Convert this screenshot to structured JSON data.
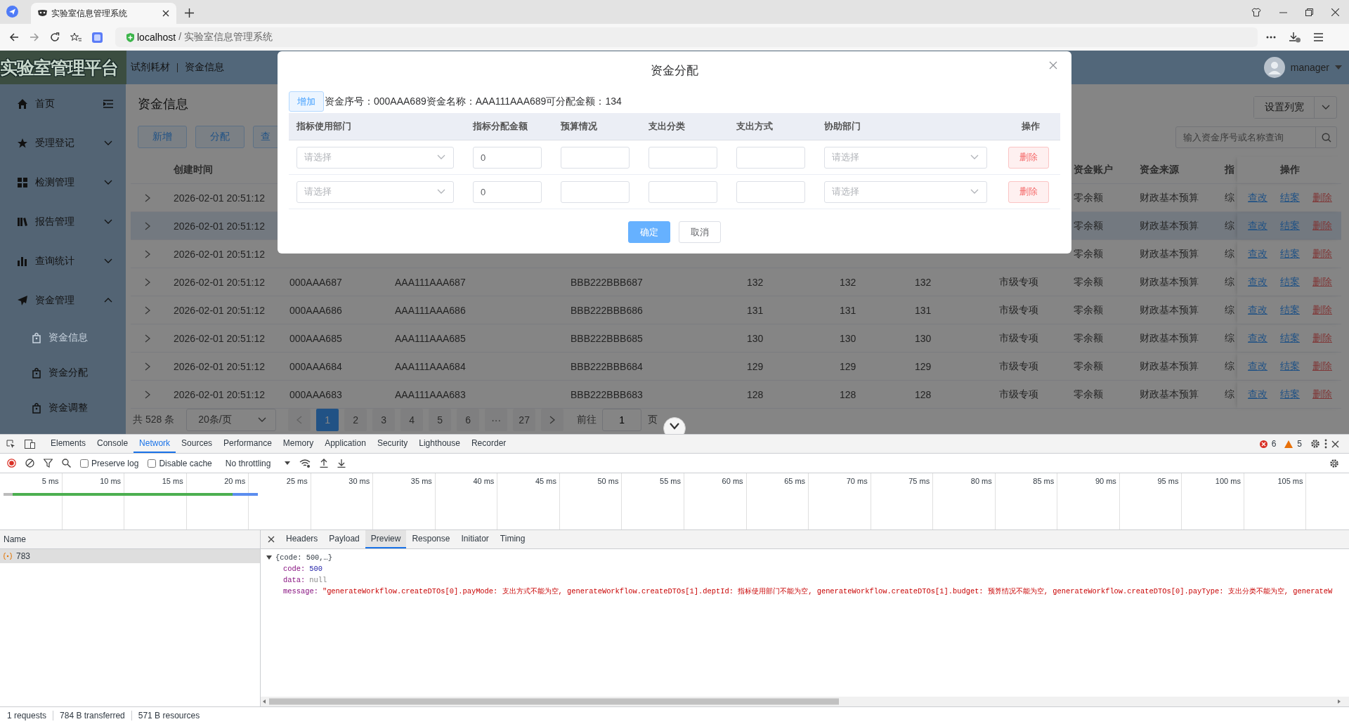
{
  "browser": {
    "tab_title": "实验室信息管理系统",
    "address": {
      "host": "localhost",
      "path": "/ 实验室信息管理系统"
    }
  },
  "header": {
    "logo": "实验室管理平台",
    "breadcrumbs": [
      "试剂耗材",
      "资金信息"
    ],
    "user": "manager"
  },
  "sidebar": {
    "items": [
      {
        "label": "首页",
        "kind": "link"
      },
      {
        "label": "受理登记",
        "kind": "group",
        "expanded": false
      },
      {
        "label": "检测管理",
        "kind": "group",
        "expanded": false
      },
      {
        "label": "报告管理",
        "kind": "group",
        "expanded": false
      },
      {
        "label": "查询统计",
        "kind": "group",
        "expanded": false
      },
      {
        "label": "资金管理",
        "kind": "group",
        "expanded": true,
        "children": [
          {
            "label": "资金信息",
            "selected": true
          },
          {
            "label": "资金分配",
            "selected": false
          },
          {
            "label": "资金调整",
            "selected": false
          }
        ]
      }
    ]
  },
  "page": {
    "title": "资金信息",
    "buttons": [
      "新增",
      "分配",
      "查"
    ],
    "column_width_button": "设置列宽",
    "search": {
      "placeholder": "输入资金序号或名称查询"
    }
  },
  "table": {
    "columns": {
      "time": "创建时间",
      "account": "资金账户",
      "source": "资金来源",
      "indicator": "指",
      "actions": "操作"
    },
    "rows": [
      {
        "time": "2026-02-01 20:51:12",
        "account": "零余额",
        "source": "财政基本预算",
        "indicator": "综",
        "actions": [
          "查改",
          "结案",
          "删除"
        ],
        "selected": false
      },
      {
        "time": "2026-02-01 20:51:12",
        "account": "零余额",
        "source": "财政基本预算",
        "indicator": "综",
        "actions": [
          "查改",
          "结案",
          "删除"
        ],
        "selected": true
      },
      {
        "time": "2026-02-01 20:51:12",
        "account": "零余额",
        "source": "财政基本预算",
        "indicator": "综",
        "actions": [
          "查改",
          "结案",
          "删除"
        ],
        "selected": false
      },
      {
        "time": "2026-02-01 20:51:12",
        "column_2": "000AAA687",
        "column_3": "AAA111AAA687",
        "column_4": "BBB222BBB687",
        "column_5": "132",
        "column_6": "132",
        "column_7": "132",
        "column_8": "市级专项",
        "account": "零余额",
        "source": "财政基本预算",
        "indicator": "综",
        "actions": [
          "查改",
          "结案",
          "删除"
        ],
        "selected": false
      },
      {
        "time": "2026-02-01 20:51:12",
        "column_2": "000AAA686",
        "column_3": "AAA111AAA686",
        "column_4": "BBB222BBB686",
        "column_5": "131",
        "column_6": "131",
        "column_7": "131",
        "column_8": "市级专项",
        "account": "零余额",
        "source": "财政基本预算",
        "indicator": "综",
        "actions": [
          "查改",
          "结案",
          "删除"
        ],
        "selected": false
      },
      {
        "time": "2026-02-01 20:51:12",
        "column_2": "000AAA685",
        "column_3": "AAA111AAA685",
        "column_4": "BBB222BBB685",
        "column_5": "130",
        "column_6": "130",
        "column_7": "130",
        "column_8": "市级专项",
        "account": "零余额",
        "source": "财政基本预算",
        "indicator": "综",
        "actions": [
          "查改",
          "结案",
          "删除"
        ],
        "selected": false
      },
      {
        "time": "2026-02-01 20:51:12",
        "column_2": "000AAA684",
        "column_3": "AAA111AAA684",
        "column_4": "BBB222BBB684",
        "column_5": "129",
        "column_6": "129",
        "column_7": "129",
        "column_8": "市级专项",
        "account": "零余额",
        "source": "财政基本预算",
        "indicator": "综",
        "actions": [
          "查改",
          "结案",
          "删除"
        ],
        "selected": false
      },
      {
        "time": "2026-02-01 20:51:12",
        "column_2": "000AAA683",
        "column_3": "AAA111AAA683",
        "column_4": "BBB222BBB683",
        "column_5": "128",
        "column_6": "128",
        "column_7": "128",
        "column_8": "市级专项",
        "account": "零余额",
        "source": "财政基本预算",
        "indicator": "综",
        "actions": [
          "查改",
          "结案",
          "删除"
        ],
        "selected": false
      }
    ]
  },
  "pagination": {
    "total": "共 528 条",
    "page_size": "20条/页",
    "pages": [
      {
        "label": "1",
        "selected": true
      },
      {
        "label": "2",
        "selected": false
      },
      {
        "label": "3",
        "selected": false
      },
      {
        "label": "4",
        "selected": false
      },
      {
        "label": "5",
        "selected": false
      },
      {
        "label": "6",
        "selected": false
      },
      {
        "label": "···",
        "selected": false
      },
      {
        "label": "27",
        "selected": false
      }
    ],
    "goto_label": "前往",
    "goto_value": "1",
    "goto_suffix": "页"
  },
  "dialog": {
    "title": "资金分配",
    "add_button": "增加",
    "info": "资金序号：000AAA689资金名称：AAA111AAA689可分配金额：134",
    "columns": [
      "指标使用部门",
      "指标分配金额",
      "预算情况",
      "支出分类",
      "支出方式",
      "协助部门",
      "操作"
    ],
    "rows": [
      {
        "dept": {
          "placeholder": "请选择"
        },
        "amount": "0",
        "assist": {
          "placeholder": "请选择"
        },
        "delete": "删除"
      },
      {
        "dept": {
          "placeholder": "请选择"
        },
        "amount": "0",
        "assist": {
          "placeholder": "请选择"
        },
        "delete": "删除"
      }
    ],
    "confirm": "确定",
    "cancel": "取消"
  },
  "devtools": {
    "tabs": [
      {
        "label": "Elements",
        "selected": false
      },
      {
        "label": "Console",
        "selected": false
      },
      {
        "label": "Network",
        "selected": true
      },
      {
        "label": "Sources",
        "selected": false
      },
      {
        "label": "Performance",
        "selected": false
      },
      {
        "label": "Memory",
        "selected": false
      },
      {
        "label": "Application",
        "selected": false
      },
      {
        "label": "Security",
        "selected": false
      },
      {
        "label": "Lighthouse",
        "selected": false
      },
      {
        "label": "Recorder",
        "selected": false
      }
    ],
    "errors": "6",
    "warnings": "5",
    "toolbar": {
      "preserve_log": {
        "label": "Preserve log",
        "checked": false
      },
      "disable_cache": {
        "label": "Disable cache",
        "checked": false
      },
      "throttling": "No throttling"
    },
    "timeline": {
      "ticks": [
        "5 ms",
        "10 ms",
        "15 ms",
        "20 ms",
        "25 ms",
        "30 ms",
        "35 ms",
        "40 ms",
        "45 ms",
        "50 ms",
        "55 ms",
        "60 ms",
        "65 ms",
        "70 ms",
        "75 ms",
        "80 ms",
        "85 ms",
        "90 ms",
        "95 ms",
        "100 ms",
        "105 ms"
      ]
    },
    "requests": {
      "header": "Name",
      "items": [
        {
          "name": "783",
          "selected": true
        }
      ]
    },
    "detail_tabs": [
      {
        "label": "Headers",
        "selected": false
      },
      {
        "label": "Payload",
        "selected": false
      },
      {
        "label": "Preview",
        "selected": true
      },
      {
        "label": "Response",
        "selected": false
      },
      {
        "label": "Initiator",
        "selected": false
      },
      {
        "label": "Timing",
        "selected": false
      }
    ],
    "preview": {
      "summary": "{code: 500,…}",
      "expanded": true,
      "fields": [
        {
          "key": "code:",
          "value": "500",
          "kind": "number"
        },
        {
          "key": "data:",
          "value": "null",
          "kind": "null"
        },
        {
          "key": "message:",
          "value": "\"generateWorkflow.createDTOs[0].payMode: 支出方式不能为空, generateWorkflow.createDTOs[1].deptId: 指标使用部门不能为空, generateWorkflow.createDTOs[1].budget: 预算情况不能为空, generateWorkflow.createDTOs[0].payType: 支出分类不能为空, generateW",
          "kind": "string"
        }
      ]
    },
    "status": [
      "1 requests",
      "784 B transferred",
      "571 B resources"
    ]
  }
}
